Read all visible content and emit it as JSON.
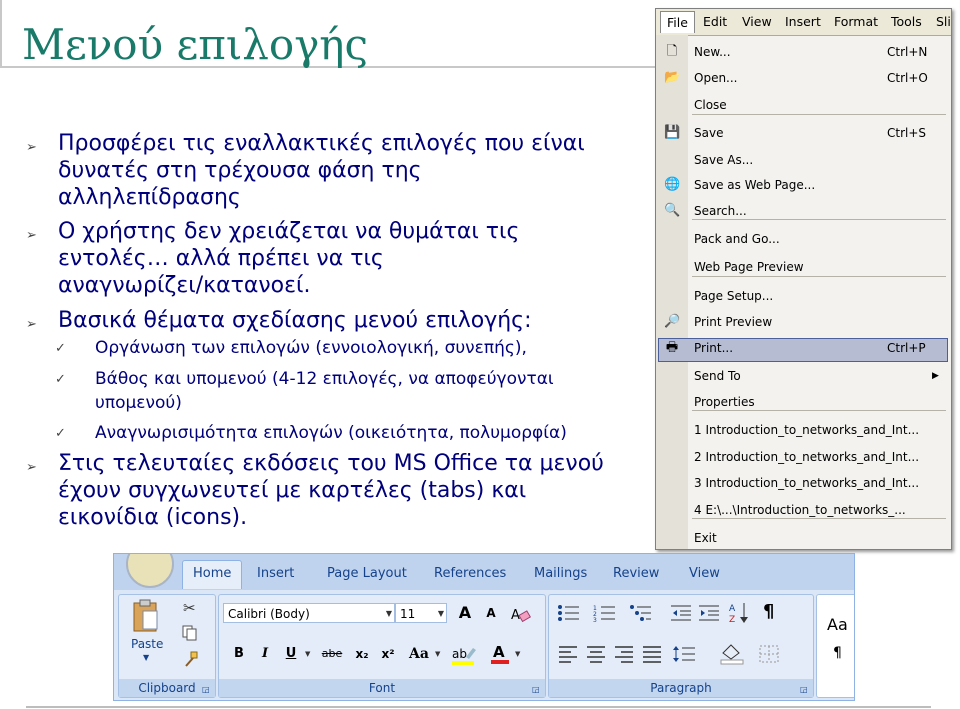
{
  "slide": {
    "title": "Μενού επιλογής",
    "bullets": [
      {
        "lines": [
          "Προσφέρει τις εναλλακτικές επιλογές που είναι",
          "δυνατές στη τρέχουσα φάση της",
          "αλληλεπίδρασης"
        ]
      },
      {
        "lines": [
          "Ο χρήστης δεν χρειάζεται να θυμάται τις",
          "εντολές… αλλά πρέπει να τις",
          "αναγνωρίζει/κατανοεί."
        ]
      },
      {
        "lines": [
          "Βασικά θέματα σχεδίασης μενού επιλογής:"
        ]
      },
      {
        "lines": [
          "Στις τελευταίες εκδόσεις του MS Office τα μενού",
          "έχουν συγχωνευτεί με καρτέλες (tabs) και",
          "εικονίδια (icons)."
        ]
      }
    ],
    "subbullets": [
      {
        "lines": [
          "Οργάνωση των επιλογών (εννοιολογική, συνεπής),"
        ]
      },
      {
        "lines": [
          "Βάθος και υπομενού (4-12 επιλογές, να αποφεύγονται",
          "υπομενού)"
        ]
      },
      {
        "lines": [
          "Αναγνωρισιμότητα επιλογών (οικειότητα, πολυμορφία)"
        ]
      }
    ],
    "marker_main": "➢",
    "marker_sub": "✓"
  },
  "file_menu": {
    "menubar": [
      "File",
      "Edit",
      "View",
      "Insert",
      "Format",
      "Tools",
      "Sli"
    ],
    "items": [
      {
        "label": "New...",
        "shortcut": "Ctrl+N",
        "icon": "new-document-icon"
      },
      {
        "label": "Open...",
        "shortcut": "Ctrl+O",
        "icon": "open-folder-icon"
      },
      {
        "label": "Close",
        "shortcut": ""
      },
      {
        "label": "Save",
        "shortcut": "Ctrl+S",
        "icon": "save-disk-icon"
      },
      {
        "label": "Save As...",
        "shortcut": ""
      },
      {
        "label": "Save as Web Page...",
        "shortcut": "",
        "icon": "web-page-icon"
      },
      {
        "label": "Search...",
        "shortcut": "",
        "icon": "search-icon"
      },
      {
        "label": "Pack and Go...",
        "shortcut": ""
      },
      {
        "label": "Web Page Preview",
        "shortcut": ""
      },
      {
        "label": "Page Setup...",
        "shortcut": ""
      },
      {
        "label": "Print Preview",
        "shortcut": "",
        "icon": "print-preview-icon"
      },
      {
        "label": "Print...",
        "shortcut": "Ctrl+P",
        "icon": "printer-icon"
      },
      {
        "label": "Send To",
        "shortcut": ""
      },
      {
        "label": "Properties",
        "shortcut": ""
      },
      {
        "label": "1 Introduction_to_networks_and_Int...",
        "shortcut": ""
      },
      {
        "label": "2 Introduction_to_networks_and_Int...",
        "shortcut": ""
      },
      {
        "label": "3 Introduction_to_networks_and_Int...",
        "shortcut": ""
      },
      {
        "label": "4 E:\\...\\Introduction_to_networks_...",
        "shortcut": ""
      },
      {
        "label": "Exit",
        "shortcut": ""
      }
    ],
    "highlighted": "Print..."
  },
  "ribbon": {
    "tabs": [
      "Home",
      "Insert",
      "Page Layout",
      "References",
      "Mailings",
      "Review",
      "View"
    ],
    "active_tab": "Home",
    "clipboard": {
      "label": "Clipboard",
      "paste": "Paste"
    },
    "font": {
      "label": "Font",
      "font_name": "Calibri (Body)",
      "font_size": "11",
      "bold": "B",
      "italic": "I",
      "underline": "U",
      "strike": "abe",
      "subscript": "x₂",
      "superscript": "x²",
      "change_case": "Aa",
      "grow": "A",
      "shrink": "A"
    },
    "paragraph": {
      "label": "Paragraph",
      "pilcrow": "¶"
    },
    "styles": {
      "sample": "Aa",
      "pilcrow": "¶"
    }
  },
  "colors": {
    "title": "#1a7a6a",
    "body_text": "#00007a",
    "menu_highlight": "#b6bdd2",
    "ribbon_bg": "#dbe7f7"
  }
}
